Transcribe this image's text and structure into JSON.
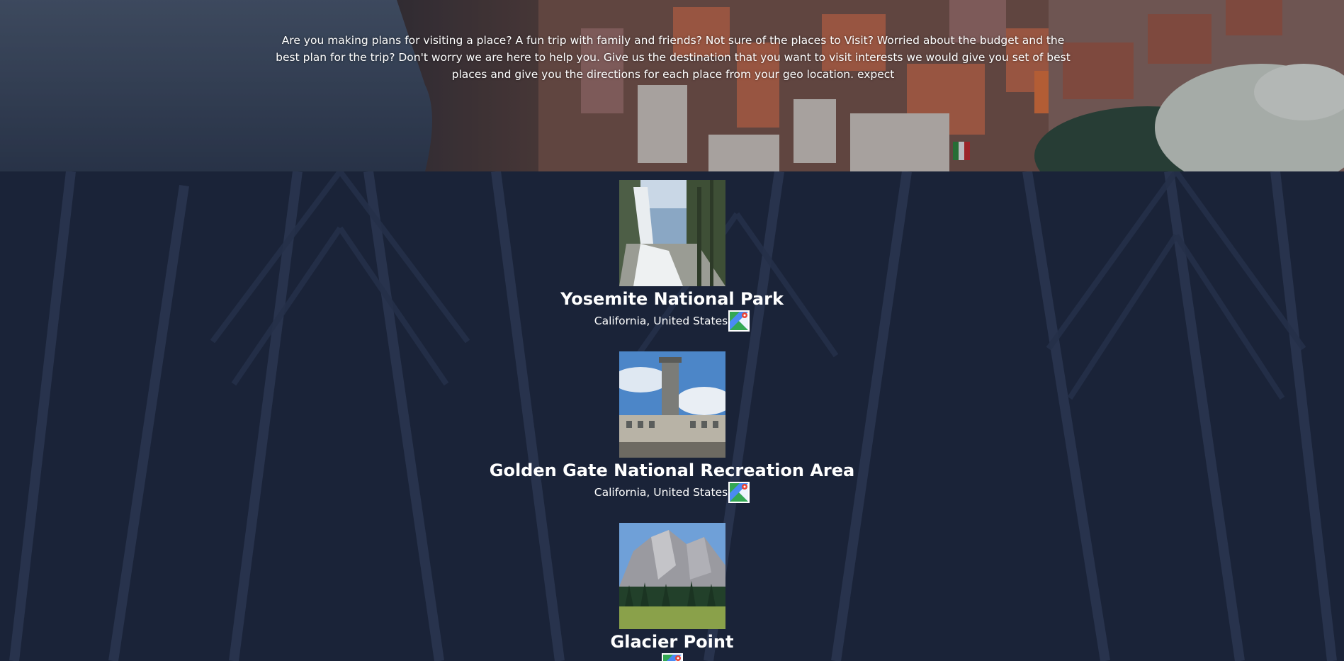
{
  "hero": {
    "description": "Are you making plans for visiting a place? A fun trip with family and friends? Not sure of the places to Visit? Worried about the budget and the best plan for the trip? Don't worry we are here to help you. Give us the destination that you want to visit interests we would give you set of best places and give you the directions for each place from your geo location. expect"
  },
  "places": [
    {
      "name": "Yosemite National Park",
      "location": "California, United States",
      "image": "waterfall-photo",
      "map_icon": "google-maps-icon"
    },
    {
      "name": "Golden Gate National Recreation Area",
      "location": "California, United States",
      "image": "lighthouse-photo",
      "map_icon": "google-maps-icon"
    },
    {
      "name": "Glacier Point",
      "location": "",
      "image": "mountain-photo",
      "map_icon": "google-maps-icon"
    }
  ],
  "colors": {
    "listing_background": "#1a2338",
    "text": "#ffffff"
  }
}
